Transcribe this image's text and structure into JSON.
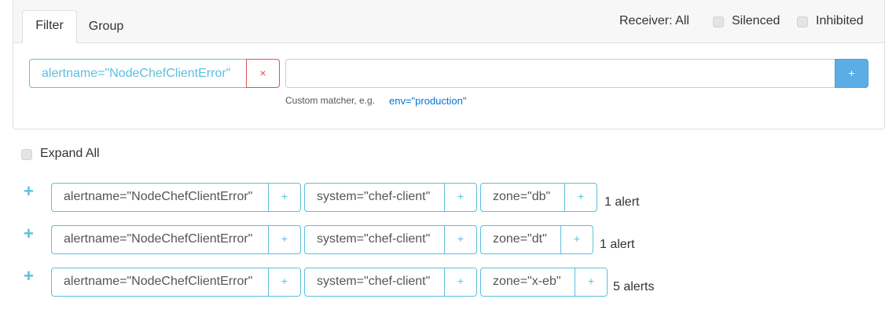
{
  "tabs": [
    {
      "label": "Filter",
      "active": true
    },
    {
      "label": "Group",
      "active": false
    }
  ],
  "header": {
    "receiver_label": "Receiver: All",
    "silenced_label": "Silenced",
    "inhibited_label": "Inhibited"
  },
  "filter": {
    "active_matcher": "alertname=\"NodeChefClientError\"",
    "remove_icon": "×",
    "input_value": "",
    "add_icon": "+",
    "help_text": "Custom matcher, e.g.",
    "help_example": "env=\"production\""
  },
  "expand_all_label": "Expand All",
  "groups": [
    {
      "labels": [
        "alertname=\"NodeChefClientError\"",
        "system=\"chef-client\"",
        "zone=\"db\""
      ],
      "count": "1 alert"
    },
    {
      "labels": [
        "alertname=\"NodeChefClientError\"",
        "system=\"chef-client\"",
        "zone=\"dt\""
      ],
      "count": "1 alert"
    },
    {
      "labels": [
        "alertname=\"NodeChefClientError\"",
        "system=\"chef-client\"",
        "zone=\"x-eb\""
      ],
      "count": "5 alerts"
    }
  ],
  "icons": {
    "plus": "+"
  },
  "colors": {
    "accent": "#5bc0de",
    "danger": "#d9534f",
    "primary": "#5bade5",
    "link": "#0275d8"
  }
}
